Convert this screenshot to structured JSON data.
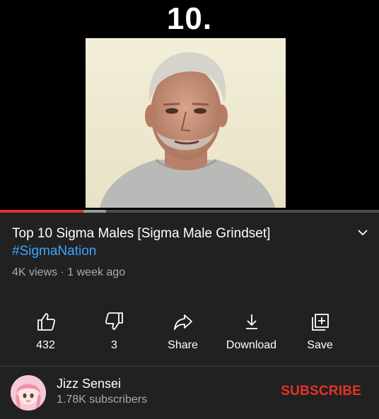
{
  "player": {
    "overlay_text": "10.",
    "progress_played_fraction": 0.22,
    "progress_buffered_fraction": 0.28
  },
  "video": {
    "title": "Top 10 Sigma Males [Sigma Male Grindset]",
    "hashtag": "#SigmaNation",
    "views": "4K views",
    "age": "1 week ago",
    "separator": "·"
  },
  "actions": {
    "like_count": "432",
    "dislike_count": "3",
    "share_label": "Share",
    "download_label": "Download",
    "save_label": "Save"
  },
  "channel": {
    "name": "Jizz Sensei",
    "subscribers": "1.78K subscribers",
    "subscribe_label": "SUBSCRIBE"
  },
  "colors": {
    "background": "#212121",
    "link": "#3ea6ff",
    "subscribe": "#e33326",
    "progress": "#e03224",
    "secondary_text": "#aaaaaa"
  },
  "icons": [
    "chevron-down-icon",
    "like-icon",
    "dislike-icon",
    "share-icon",
    "download-icon",
    "save-playlist-icon"
  ]
}
